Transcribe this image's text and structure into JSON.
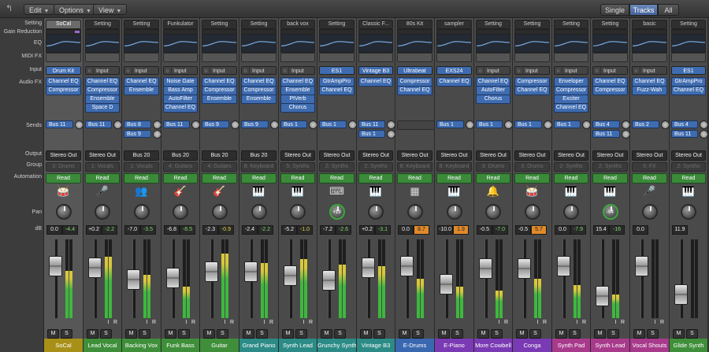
{
  "toolbar": {
    "back_icon": "back-arrow-icon",
    "edit_label": "Edit",
    "options_label": "Options",
    "view_label": "View",
    "view_modes": [
      "Single",
      "Tracks",
      "All"
    ],
    "active_view_mode": "Tracks"
  },
  "row_labels": {
    "setting": "Setting",
    "gain_reduction": "Gain Reduction",
    "eq": "EQ",
    "midi_fx": "MIDI FX",
    "input": "Input",
    "audio_fx": "Audio FX",
    "sends": "Sends",
    "output": "Output",
    "group": "Group",
    "automation": "Automation",
    "pan": "Pan",
    "db": "dB"
  },
  "colors": {
    "yellow": "#a89018",
    "green": "#3f8f3a",
    "teal": "#2c8b86",
    "blue": "#3a68b0",
    "purple": "#7a3ab4",
    "pink": "#a83a8c"
  },
  "strips": [
    {
      "setting": "SoCal",
      "input": "Drum Kit",
      "input_type": "inst",
      "fx": [
        "Channel EQ",
        "Compressor"
      ],
      "sends": [
        "Bus 11"
      ],
      "output": "Stereo Out",
      "group": "3: Drums",
      "automation": "Read",
      "icon": "drum-kit-icon",
      "icon_char": "🥁",
      "pan": "",
      "vol": "0.0",
      "peak": "-4.4",
      "peak_style": "g",
      "fader": 0.72,
      "meter": 0.6,
      "ms": [
        "M",
        "S"
      ],
      "has_ir": false,
      "name": "SoCal",
      "color": "#a89018",
      "selected": true
    },
    {
      "setting": "Setting",
      "input": "Input",
      "input_type": "audio",
      "fx": [
        "Channel EQ",
        "Compressor",
        "Ensemble",
        "Space D"
      ],
      "sends": [
        "Bus 11"
      ],
      "output": "Stereo Out",
      "group": "1: Vocals",
      "automation": "Read",
      "icon": "microphone-icon",
      "icon_char": "🎤",
      "pan": "",
      "vol": "+0.2",
      "peak": "-2.2",
      "peak_style": "g",
      "fader": 0.7,
      "meter": 0.78,
      "ms": [
        "M",
        "S"
      ],
      "has_ir": true,
      "name": "Lead Vocal",
      "color": "#3f8f3a",
      "selected": false
    },
    {
      "setting": "Setting",
      "input": "Input",
      "input_type": "audio",
      "fx": [
        "Channel EQ",
        "Ensemble"
      ],
      "sends": [
        "Bus 8",
        "Bus 9"
      ],
      "output": "Bus 20",
      "group": "1: Vocals",
      "automation": "Read",
      "icon": "choir-icon",
      "icon_char": "👥",
      "pan": "",
      "vol": "-7.0",
      "peak": "-3.5",
      "peak_style": "g",
      "fader": 0.5,
      "meter": 0.55,
      "ms": [
        "M",
        "S"
      ],
      "has_ir": true,
      "name": "Backing Vox",
      "color": "#3f8f3a",
      "selected": false
    },
    {
      "setting": "Funkulator",
      "input": "Input",
      "input_type": "audio",
      "fx": [
        "Noise Gate",
        "Bass Amp",
        "AutoFilter",
        "Channel EQ"
      ],
      "sends": [
        "Bus 11"
      ],
      "output": "Bus 20",
      "group": "4: Guitars",
      "automation": "Read",
      "icon": "bass-guitar-icon",
      "icon_char": "🎸",
      "pan": "",
      "vol": "-6.8",
      "peak": "-8.5",
      "peak_style": "g",
      "fader": 0.52,
      "meter": 0.4,
      "ms": [
        "M",
        "S"
      ],
      "has_ir": true,
      "name": "Funk Bass",
      "color": "#3f8f3a",
      "selected": false
    },
    {
      "setting": "Setting",
      "input": "Input",
      "input_type": "audio",
      "fx": [
        "Channel EQ",
        "Compressor",
        "Ensemble"
      ],
      "sends": [
        "Bus 9"
      ],
      "output": "Bus 20",
      "group": "4: Guitars",
      "automation": "Read",
      "icon": "guitar-icon",
      "icon_char": "🎸",
      "pan": "",
      "vol": "-2.3",
      "peak": "-0.9",
      "peak_style": "y",
      "fader": 0.63,
      "meter": 0.82,
      "ms": [
        "M",
        "S"
      ],
      "has_ir": true,
      "name": "Guitar",
      "color": "#3f8f3a",
      "selected": false
    },
    {
      "setting": "Setting",
      "input": "Input",
      "input_type": "audio",
      "fx": [
        "Channel EQ",
        "Compressor",
        "Ensemble"
      ],
      "sends": [
        "Bus 9"
      ],
      "output": "Bus 20",
      "group": "8: Keyboard",
      "automation": "Read",
      "icon": "grand-piano-icon",
      "icon_char": "🎹",
      "pan": "",
      "vol": "-2.4",
      "peak": "-2.2",
      "peak_style": "g",
      "fader": 0.63,
      "meter": 0.7,
      "ms": [
        "M",
        "S"
      ],
      "has_ir": true,
      "name": "Grand Piano",
      "color": "#2c8b86",
      "selected": false
    },
    {
      "setting": "back vox",
      "input": "Input",
      "input_type": "audio",
      "fx": [
        "Channel EQ",
        "Ensemble",
        "PtVerb",
        "Chorus"
      ],
      "sends": [
        "Bus 1"
      ],
      "output": "Stereo Out",
      "group": "5: Synths",
      "automation": "Read",
      "icon": "synth-keyboard-icon",
      "icon_char": "🎹",
      "pan": "",
      "vol": "-5.2",
      "peak": "-1.0",
      "peak_style": "y",
      "fader": 0.56,
      "meter": 0.75,
      "ms": [
        "M",
        "S"
      ],
      "has_ir": true,
      "name": "Synth Lead",
      "color": "#2c8b86",
      "selected": false
    },
    {
      "setting": "Setting",
      "input": "ES1",
      "input_type": "inst",
      "fx": [
        "GtrAmpPro",
        "Channel EQ"
      ],
      "sends": [
        "Bus 1"
      ],
      "output": "Stereo Out",
      "group": "2: Synths",
      "automation": "Read",
      "icon": "synth-stand-icon",
      "icon_char": "⌨",
      "pan": "+19",
      "vol": "-7.2",
      "peak": "-2.6",
      "peak_style": "g",
      "fader": 0.49,
      "meter": 0.68,
      "ms": [
        "M",
        "S"
      ],
      "has_ir": false,
      "name": "Grunchy Synth",
      "color": "#2c8b86",
      "selected": false
    },
    {
      "setting": "Classic F...",
      "input": "Vintage B3",
      "input_type": "inst",
      "fx": [
        "Channel EQ"
      ],
      "sends": [
        "Bus 11",
        "Bus 1"
      ],
      "output": "Stereo Out",
      "group": "2: Synths",
      "automation": "Read",
      "icon": "organ-icon",
      "icon_char": "🎹",
      "pan": "",
      "vol": "+0.2",
      "peak": "-3.1",
      "peak_style": "g",
      "fader": 0.7,
      "meter": 0.66,
      "ms": [
        "M",
        "S"
      ],
      "has_ir": false,
      "name": "Vintage B3",
      "color": "#2c8b86",
      "selected": false
    },
    {
      "setting": "80s Kit",
      "input": "Ultrabeat",
      "input_type": "inst",
      "fx": [
        "Compressor",
        "Channel EQ"
      ],
      "sends": [],
      "output": "Stereo Out",
      "group": "8: Keyboard",
      "automation": "Read",
      "icon": "drum-machine-icon",
      "icon_char": "▦",
      "pan": "",
      "vol": "0.0",
      "peak": "8.7",
      "peak_style": "o",
      "fader": 0.72,
      "meter": 0.5,
      "ms": [
        "M",
        "S"
      ],
      "has_ir": false,
      "name": "E-Drums",
      "color": "#3a68b0",
      "selected": false
    },
    {
      "setting": "sampler",
      "input": "EXS24",
      "input_type": "inst",
      "fx": [
        "Channel EQ"
      ],
      "sends": [
        "Bus 1"
      ],
      "output": "Stereo Out",
      "group": "8: Keyboard",
      "automation": "Read",
      "icon": "electric-piano-icon",
      "icon_char": "🎹",
      "pan": "",
      "vol": "-10.0",
      "peak": "1.9",
      "peak_style": "o",
      "fader": 0.42,
      "meter": 0.4,
      "ms": [
        "M",
        "S"
      ],
      "has_ir": false,
      "name": "E-Piano",
      "color": "#7a3ab4",
      "selected": false
    },
    {
      "setting": "Setting",
      "input": "Input",
      "input_type": "audio",
      "fx": [
        "Channel EQ",
        "AutoFilter",
        "Chorus"
      ],
      "sends": [
        "Bus 1"
      ],
      "output": "Stereo Out",
      "group": "3: Drums",
      "automation": "Read",
      "icon": "cowbell-icon",
      "icon_char": "🔔",
      "pan": "",
      "vol": "-0.5",
      "peak": "-7.0",
      "peak_style": "g",
      "fader": 0.68,
      "meter": 0.35,
      "ms": [
        "M",
        "S"
      ],
      "has_ir": true,
      "name": "More Cowbell",
      "color": "#7a3ab4",
      "selected": false
    },
    {
      "setting": "Setting",
      "input": "Input",
      "input_type": "audio",
      "fx": [
        "Compressor",
        "Channel EQ"
      ],
      "sends": [
        "Bus 1"
      ],
      "output": "Stereo Out",
      "group": "3: Drums",
      "automation": "Read",
      "icon": "conga-icon",
      "icon_char": "🥁",
      "pan": "",
      "vol": "-0.5",
      "peak": "5.7",
      "peak_style": "o",
      "fader": 0.68,
      "meter": 0.5,
      "ms": [
        "M",
        "S"
      ],
      "has_ir": true,
      "name": "Conga",
      "color": "#7a3ab4",
      "selected": false
    },
    {
      "setting": "Setting",
      "input": "Input",
      "input_type": "audio",
      "fx": [
        "Enveloper",
        "Compressor",
        "Exciter",
        "Channel EQ"
      ],
      "sends": [
        "Bus 1"
      ],
      "output": "Stereo Out",
      "group": "2: Synths",
      "automation": "Read",
      "icon": "synth-pad-icon",
      "icon_char": "🎹",
      "pan": "",
      "vol": "0.0",
      "peak": "-7.9",
      "peak_style": "g",
      "fader": 0.72,
      "meter": 0.42,
      "ms": [
        "M",
        "S"
      ],
      "has_ir": true,
      "name": "Synth Pad",
      "color": "#a83a8c",
      "selected": false
    },
    {
      "setting": "Setting",
      "input": "Input",
      "input_type": "audio",
      "fx": [
        "Channel EQ",
        "Compressor"
      ],
      "sends": [
        "Bus 4",
        "Bus 11"
      ],
      "output": "Stereo Out",
      "group": "2: Synths",
      "automation": "Read",
      "icon": "synth-lead-icon",
      "icon_char": "🎹",
      "pan": "-64",
      "vol": "15.4",
      "peak": "-16",
      "peak_style": "g",
      "fader": 0.22,
      "meter": 0.3,
      "ms": [
        "M",
        "S"
      ],
      "has_ir": true,
      "name": "Synth Lead",
      "color": "#a83a8c",
      "selected": false
    },
    {
      "setting": "basic",
      "input": "Input",
      "input_type": "audio",
      "fx": [
        "Channel EQ",
        "Fuzz-Wah"
      ],
      "sends": [
        "Bus 2"
      ],
      "output": "Stereo Out",
      "group": "5: FX",
      "automation": "Read",
      "icon": "vocal-shout-icon",
      "icon_char": "🎤",
      "pan": "",
      "vol": "0.0",
      "peak": "",
      "peak_style": "g",
      "fader": 0.72,
      "meter": 0.0,
      "ms": [
        "M",
        "S"
      ],
      "has_ir": true,
      "name": "Vocal Shouts",
      "color": "#a83a8c",
      "selected": false
    },
    {
      "setting": "Setting",
      "input": "ES1",
      "input_type": "inst",
      "fx": [
        "GtrAmpPro",
        "Channel EQ"
      ],
      "sends": [
        "Bus 4",
        "Bus 11"
      ],
      "output": "Stereo Out",
      "group": "2: Synths",
      "automation": "Read",
      "icon": "synth-glide-icon",
      "icon_char": "🎹",
      "pan": "",
      "vol": "11.9",
      "peak": "",
      "peak_style": "g",
      "fader": 0.25,
      "meter": 0.0,
      "ms": [
        "M",
        "S"
      ],
      "has_ir": false,
      "name": "Glide Synth",
      "color": "#3f8f3a",
      "selected": false
    }
  ]
}
